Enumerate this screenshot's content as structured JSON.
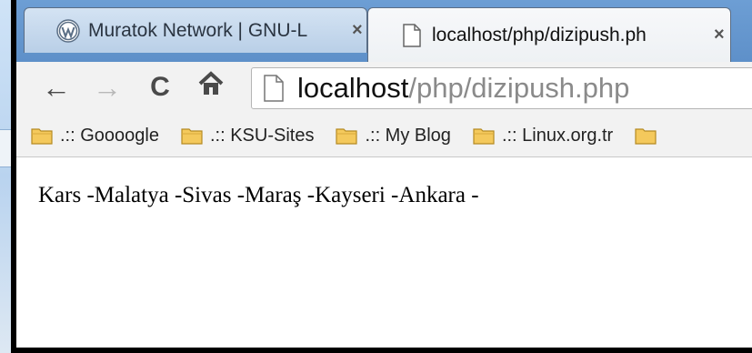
{
  "tabs": [
    {
      "title": "Muratok Network | GNU-L",
      "close": "×",
      "favicon": "wordpress-icon",
      "active": false
    },
    {
      "title": "localhost/php/dizipush.ph",
      "close": "×",
      "favicon": "page-icon",
      "active": true
    }
  ],
  "toolbar": {
    "back": "←",
    "forward": "→",
    "reload": "C",
    "home": "⌂",
    "url_host": "localhost",
    "url_path": "/php/dizipush.php"
  },
  "bookmarks": [
    {
      "label": ".:: Goooogle"
    },
    {
      "label": ".:: KSU-Sites"
    },
    {
      "label": ".:: My Blog"
    },
    {
      "label": ".:: Linux.org.tr"
    }
  ],
  "content": {
    "text": "Kars -Malatya -Sivas -Maraş -Kayseri -Ankara -"
  },
  "colors": {
    "tabstrip": "#6d9ed4",
    "folder": "#f4c95c"
  }
}
